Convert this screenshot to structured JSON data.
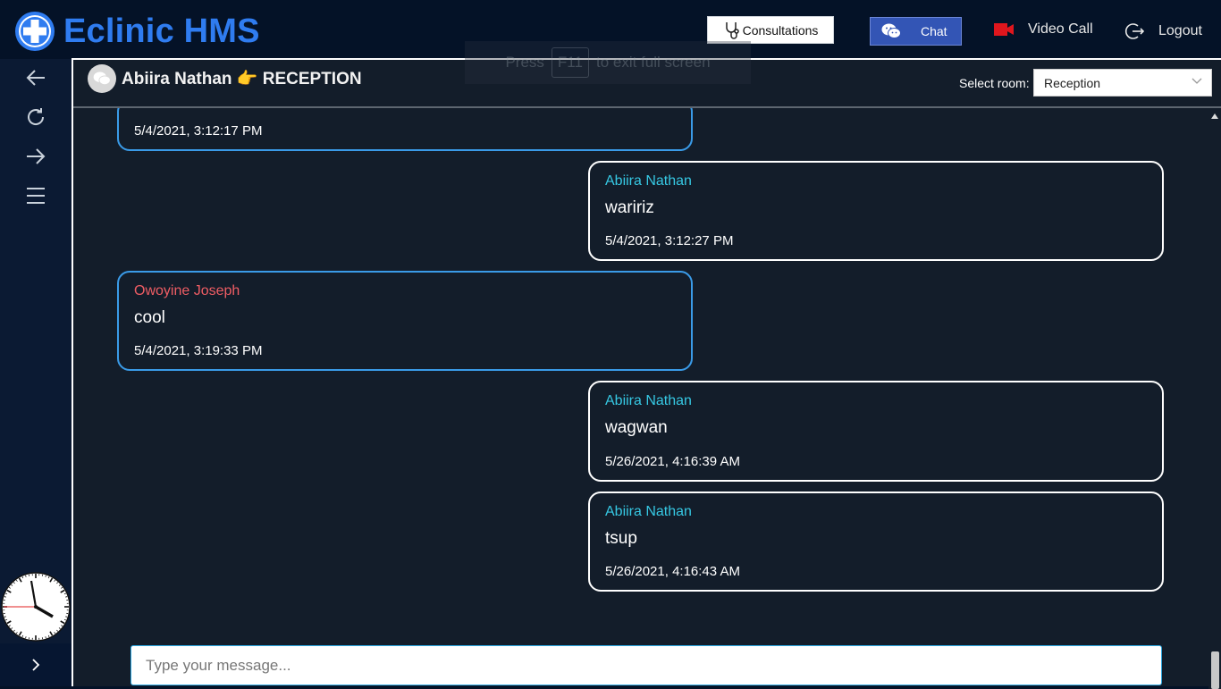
{
  "app": {
    "title": "Eclinic HMS"
  },
  "header": {
    "consultations_label": "Consultations",
    "chat_label": "Chat",
    "video_call_label": "Video Call",
    "logout_label": "Logout"
  },
  "fullscreen_hint": {
    "prefix": "Press",
    "key": "F11",
    "suffix": "to exit full screen"
  },
  "chat": {
    "title": "Abiira Nathan 👉 RECEPTION",
    "select_label": "Select room:",
    "selected_room": "Reception",
    "messages": [
      {
        "sender": "",
        "text": "",
        "time": "5/4/2021, 3:12:17 PM",
        "side": "left"
      },
      {
        "sender": "Abiira Nathan",
        "text": "waririz",
        "time": "5/4/2021, 3:12:27 PM",
        "side": "right"
      },
      {
        "sender": "Owoyine Joseph",
        "text": "cool",
        "time": "5/4/2021, 3:19:33 PM",
        "side": "left"
      },
      {
        "sender": "Abiira Nathan",
        "text": "wagwan",
        "time": "5/26/2021, 4:16:39 AM",
        "side": "right"
      },
      {
        "sender": "Abiira Nathan",
        "text": "tsup",
        "time": "5/26/2021, 4:16:43 AM",
        "side": "right"
      }
    ],
    "input_placeholder": "Type your message..."
  },
  "colors": {
    "brand": "#2f7cf0",
    "sidebar_bg": "#0b1a33",
    "panel_bg": "#131d2a",
    "left_bubble_border": "#3a9be8",
    "right_bubble_border": "#ffffff",
    "other_sender": "#ef5d64",
    "self_sender": "#36c8e3",
    "video_icon": "#e0161d"
  }
}
